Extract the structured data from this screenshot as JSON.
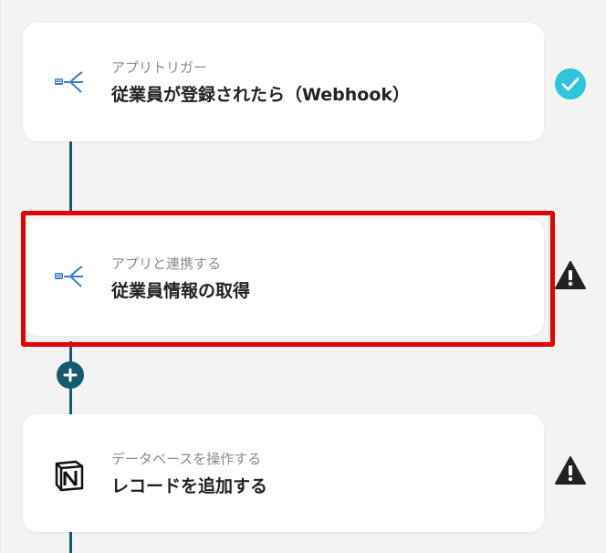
{
  "flow": {
    "steps": [
      {
        "subtitle": "アプリトリガー",
        "title": "従業員が登録されたら（Webhook）",
        "icon": "bird-app-icon",
        "status": "completed",
        "status_icon": "check-circle-icon"
      },
      {
        "subtitle": "アプリと連携する",
        "title": "従業員情報の取得",
        "icon": "bird-app-icon",
        "status": "warning",
        "status_icon": "warning-icon",
        "highlighted": true
      },
      {
        "subtitle": "データベースを操作する",
        "title": "レコードを追加する",
        "icon": "notion-icon",
        "status": "warning",
        "status_icon": "warning-icon"
      }
    ],
    "add_step_icon": "plus-icon"
  },
  "colors": {
    "connector": "#165a70",
    "highlight": "#e60000",
    "check": "#2cc5dc",
    "warning": "#222222",
    "app_icon_blue": "#3a7bd5"
  }
}
